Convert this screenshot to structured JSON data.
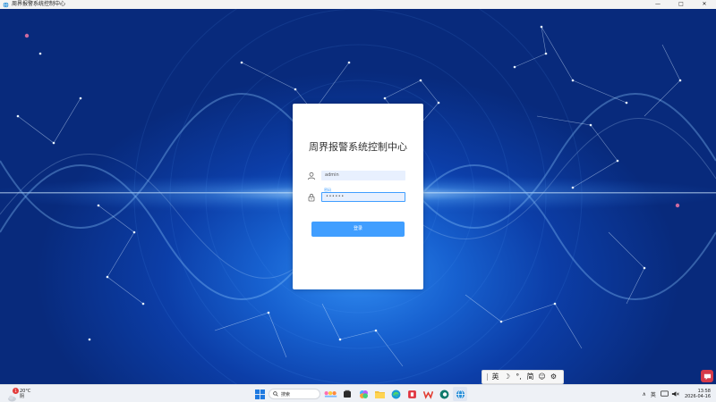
{
  "window": {
    "title": "周界报警系统控制中心",
    "controls": {
      "minimize": "—",
      "maximize": "□",
      "close": "✕"
    }
  },
  "login": {
    "heading": "周界报警系统控制中心",
    "username_value": "admin",
    "password_label": "密码",
    "password_value": "••••••",
    "login_button": "登录"
  },
  "ime_toolbar": {
    "grip": "|",
    "lang": "英",
    "moon": "☽",
    "punct": "°,",
    "mode": "简",
    "emoji": "☺",
    "settings": "⚙"
  },
  "taskbar": {
    "weather": {
      "temp": "20°C",
      "condition": "阴",
      "badge": "1"
    },
    "search_label": "搜索",
    "tray": {
      "chevron": "∧",
      "ime": "英",
      "clock_time": "13:58",
      "clock_date": "2026-04-16"
    }
  },
  "colors": {
    "accent": "#409eff",
    "background_deep": "#082a7c",
    "background_glow": "#2f8af0",
    "notification": "#d63a4a"
  }
}
